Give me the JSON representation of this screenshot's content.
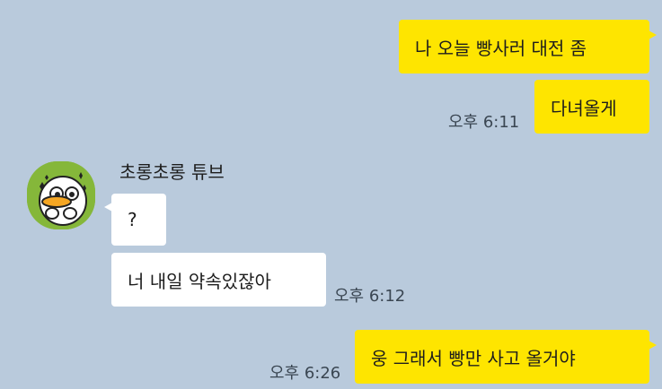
{
  "messages": [
    {
      "text": "나 오늘 빵사러 대전 좀"
    },
    {
      "text": "다녀올게",
      "time": "오후 6:11"
    },
    {
      "text": "?"
    },
    {
      "text": "너 내일 약속있잖아",
      "time": "오후 6:12"
    },
    {
      "text": "웅 그래서 빵만 사고 올거야",
      "time": "오후 6:26"
    }
  ],
  "contact": {
    "name": "초롱초롱 튜브",
    "avatar_icon": "tube-duck-avatar-icon"
  },
  "colors": {
    "background": "#b9cadc",
    "my_bubble": "#fee500",
    "their_bubble": "#ffffff",
    "avatar_bg": "#85b73a"
  }
}
